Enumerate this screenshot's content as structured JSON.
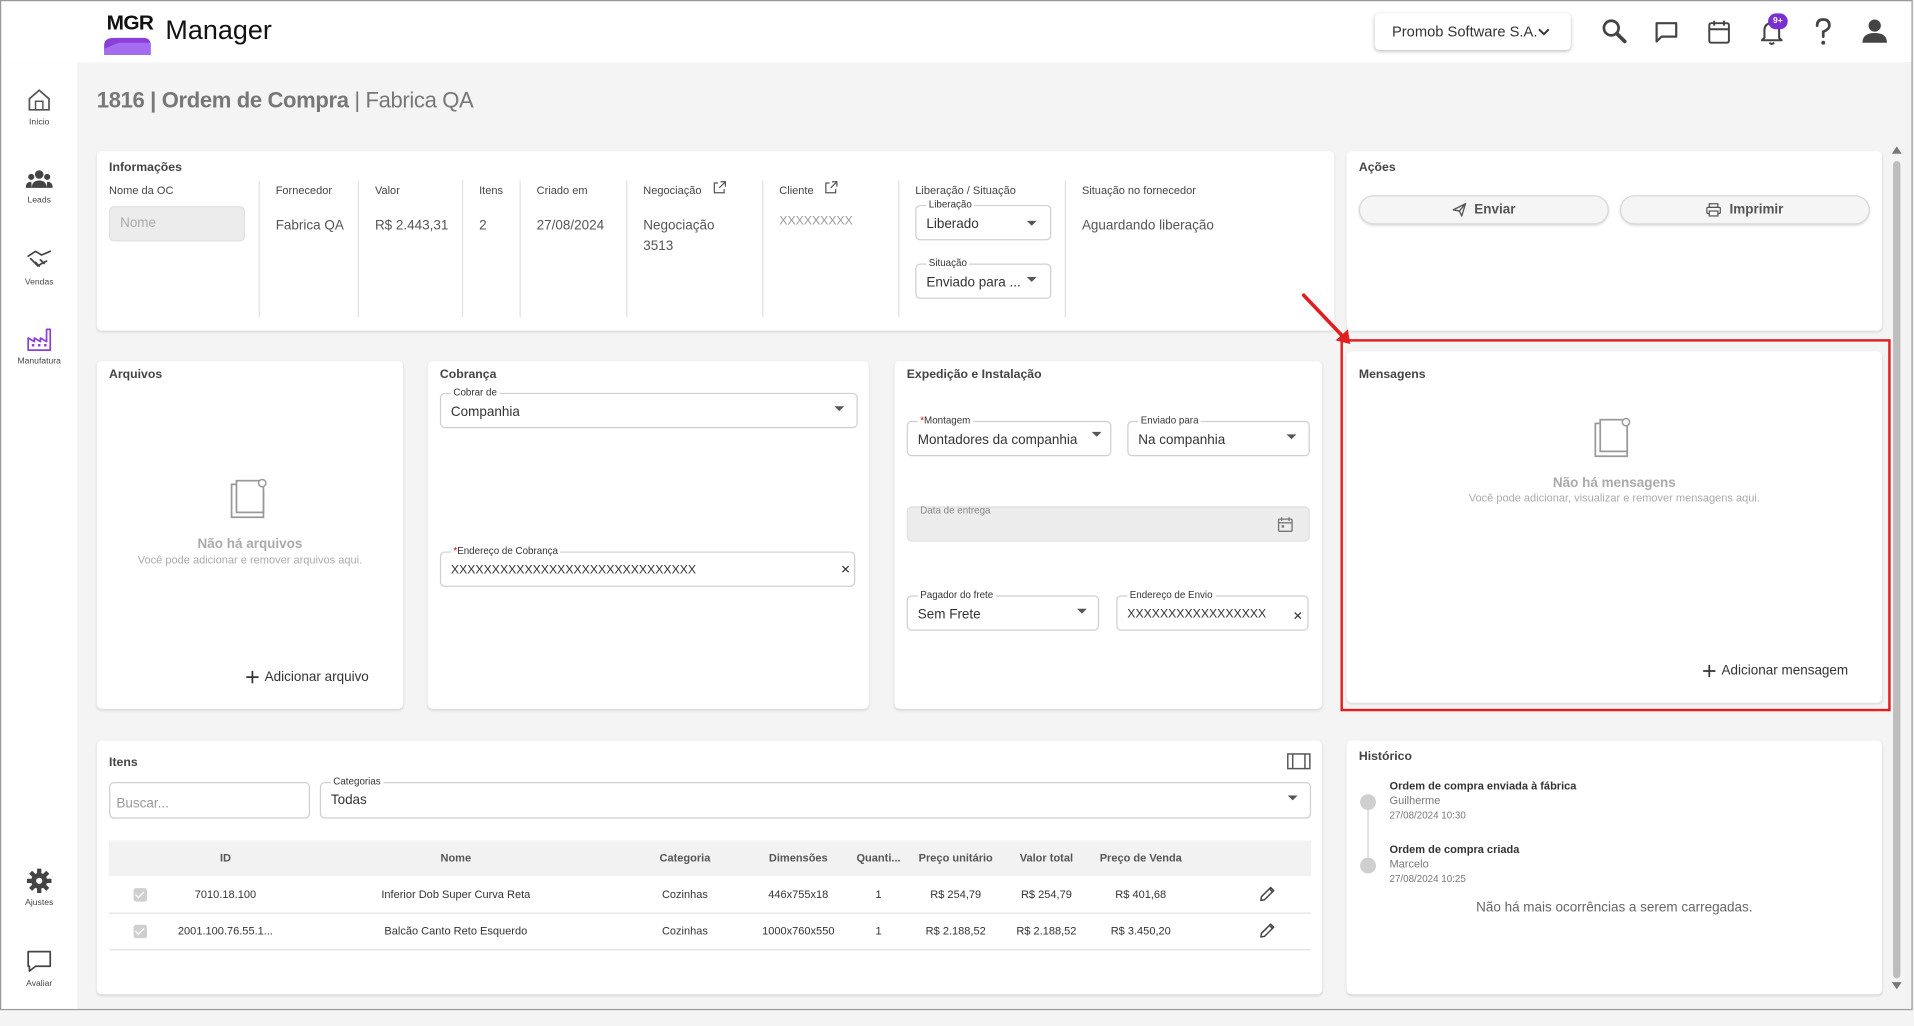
{
  "app": {
    "logo_text": "MGR",
    "name": "Manager"
  },
  "header": {
    "company_selector": "Promob Software S.A.",
    "notification_badge": "9+"
  },
  "sidebar": {
    "items": [
      {
        "label": "Início"
      },
      {
        "label": "Leads"
      },
      {
        "label": "Vendas"
      },
      {
        "label": "Manufatura"
      },
      {
        "label": "Ajustes"
      },
      {
        "label": "Avaliar"
      }
    ]
  },
  "page": {
    "title_number": "1816",
    "title_main": "Ordem de Compra",
    "title_sub": "Fabrica QA"
  },
  "informacoes": {
    "title": "Informações",
    "nome_oc_label": "Nome da OC",
    "nome_oc_placeholder": "Nome",
    "fornecedor_label": "Fornecedor",
    "fornecedor_value": "Fabrica QA",
    "valor_label": "Valor",
    "valor_value": "R$ 2.443,31",
    "itens_label": "Itens",
    "itens_value": "2",
    "criado_label": "Criado em",
    "criado_value": "27/08/2024",
    "negociacao_label": "Negociação",
    "negociacao_value_1": "Negociação",
    "negociacao_value_2": "3513",
    "cliente_label": "Cliente",
    "cliente_value": "XXXXXXXXX",
    "liberacao_situacao_label": "Liberação / Situação",
    "liberacao_field_label": "Liberação",
    "liberacao_value": "Liberado",
    "situacao_field_label": "Situação",
    "situacao_value": "Enviado para ...",
    "situacao_fornecedor_label": "Situação no fornecedor",
    "situacao_fornecedor_value": "Aguardando liberação"
  },
  "acoes": {
    "title": "Ações",
    "enviar": "Enviar",
    "imprimir": "Imprimir"
  },
  "arquivos": {
    "title": "Arquivos",
    "empty_title": "Não há arquivos",
    "empty_sub": "Você pode adicionar e remover arquivos aqui.",
    "add": "Adicionar arquivo"
  },
  "cobranca": {
    "title": "Cobrança",
    "cobrar_label": "Cobrar de",
    "cobrar_value": "Companhia",
    "endereco_label": "Endereço de Cobrança",
    "endereco_value": "XXXXXXXXXXXXXXXXXXXXXXXXXXXXXX"
  },
  "expedicao": {
    "title": "Expedição e Instalação",
    "montagem_label": "Montagem",
    "montagem_value": "Montadores da companhia",
    "enviado_label": "Enviado para",
    "enviado_value": "Na companhia",
    "data_label": "Data de entrega",
    "frete_label": "Pagador do frete",
    "frete_value": "Sem Frete",
    "envio_label": "Endereço de Envio",
    "envio_value": "XXXXXXXXXXXXXXXXX"
  },
  "mensagens": {
    "title": "Mensagens",
    "empty_title": "Não há mensagens",
    "empty_sub": "Você pode adicionar, visualizar e remover mensagens aqui.",
    "add": "Adicionar mensagem"
  },
  "itens": {
    "title": "Itens",
    "search_placeholder": "Buscar...",
    "categorias_label": "Categorias",
    "categorias_value": "Todas",
    "columns": [
      "ID",
      "Nome",
      "Categoria",
      "Dimensões",
      "Quanti...",
      "Preço unitário",
      "Valor total",
      "Preço de Venda"
    ],
    "rows": [
      {
        "id": "7010.18.100",
        "nome": "Inferior Dob Super Curva Reta",
        "categoria": "Cozinhas",
        "dimensoes": "446x755x18",
        "quantidade": "1",
        "preco_unitario": "R$ 254,79",
        "valor_total": "R$ 254,79",
        "preco_venda": "R$ 401,68"
      },
      {
        "id": "2001.100.76.55.1...",
        "nome": "Balcão Canto Reto Esquerdo",
        "categoria": "Cozinhas",
        "dimensoes": "1000x760x550",
        "quantidade": "1",
        "preco_unitario": "R$ 2.188,52",
        "valor_total": "R$ 2.188,52",
        "preco_venda": "R$ 3.450,20"
      }
    ]
  },
  "historico": {
    "title": "Histórico",
    "events": [
      {
        "title": "Ordem de compra enviada à fábrica",
        "user": "Guilherme",
        "date": "27/08/2024 10:30"
      },
      {
        "title": "Ordem de compra criada",
        "user": "Marcelo",
        "date": "27/08/2024 10:25"
      }
    ],
    "no_more": "Não há mais ocorrências a serem carregadas."
  },
  "colors": {
    "brand_purple": "#8b3fd9",
    "highlight_red": "#e02020",
    "annotation_arrow": "#e02020"
  }
}
